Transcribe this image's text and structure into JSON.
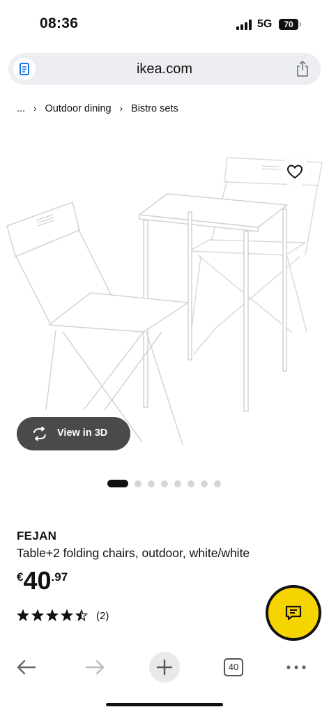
{
  "status_bar": {
    "time": "08:36",
    "network": "5G",
    "battery": "70"
  },
  "browser": {
    "url": "ikea.com",
    "icons": {
      "site": "document-icon",
      "share": "share-icon"
    }
  },
  "breadcrumb": {
    "ellipsis": "...",
    "separator": "›",
    "items": [
      "Outdoor dining",
      "Bistro sets"
    ]
  },
  "gallery": {
    "view_3d_label": "View in 3D",
    "image_count": 8,
    "active_index": 0,
    "icons": {
      "favourite": "heart-icon",
      "view_3d": "rotate-3d-icon"
    }
  },
  "product": {
    "name": "FEJAN",
    "description": "Table+2 folding chairs, outdoor, white/white",
    "price": {
      "currency": "€",
      "integer": "40",
      "decimal": ".97"
    },
    "rating": {
      "value": 4.5,
      "max": 5,
      "count_label": "(2)"
    }
  },
  "chat": {
    "icon": "chat-icon"
  },
  "toolbar": {
    "tabs_count": "40",
    "icons": [
      "back-arrow-icon",
      "forward-arrow-icon",
      "plus-icon",
      "tabs-icon",
      "more-icon"
    ]
  },
  "colors": {
    "accent_yellow": "#f6d400",
    "url_bar": "#eceef1",
    "view3d_bg": "#4a4a4a",
    "text": "#111111",
    "inactive_dot": "#d6d6d6",
    "forward_disabled": "#b8bcc4"
  }
}
